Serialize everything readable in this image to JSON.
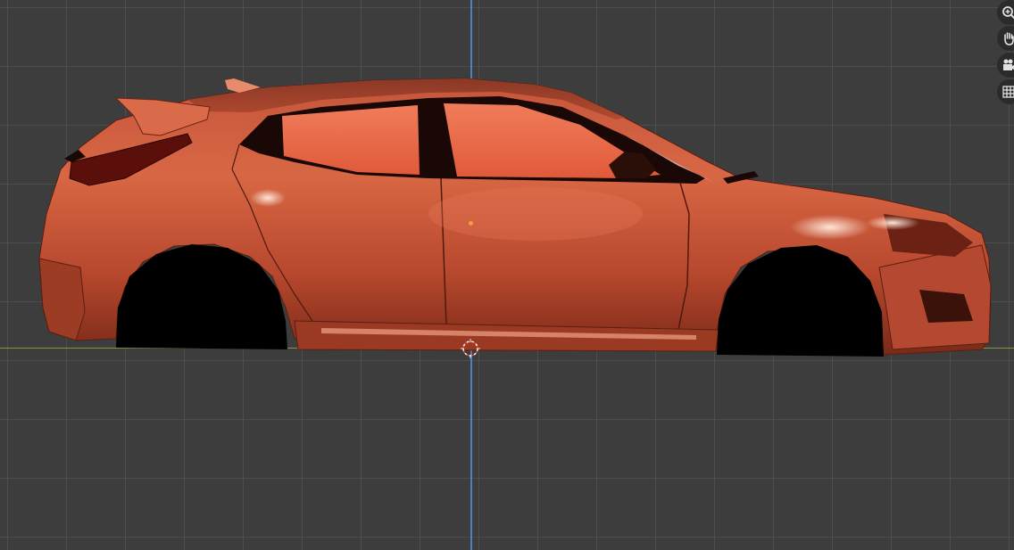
{
  "viewport": {
    "background_color": "#3d3d3d",
    "grid_color": "#505050",
    "x_axis_color": "#7c9b3c",
    "z_axis_color": "#4f7fc0",
    "object_color": "#d95a3c",
    "origin_color": "#e8a33a"
  },
  "navigation": {
    "buttons": [
      {
        "name": "zoom",
        "icon": "magnifier-plus-icon"
      },
      {
        "name": "pan",
        "icon": "hand-icon"
      },
      {
        "name": "camera",
        "icon": "camera-icon"
      },
      {
        "name": "perspective",
        "icon": "grid-icon"
      }
    ]
  }
}
